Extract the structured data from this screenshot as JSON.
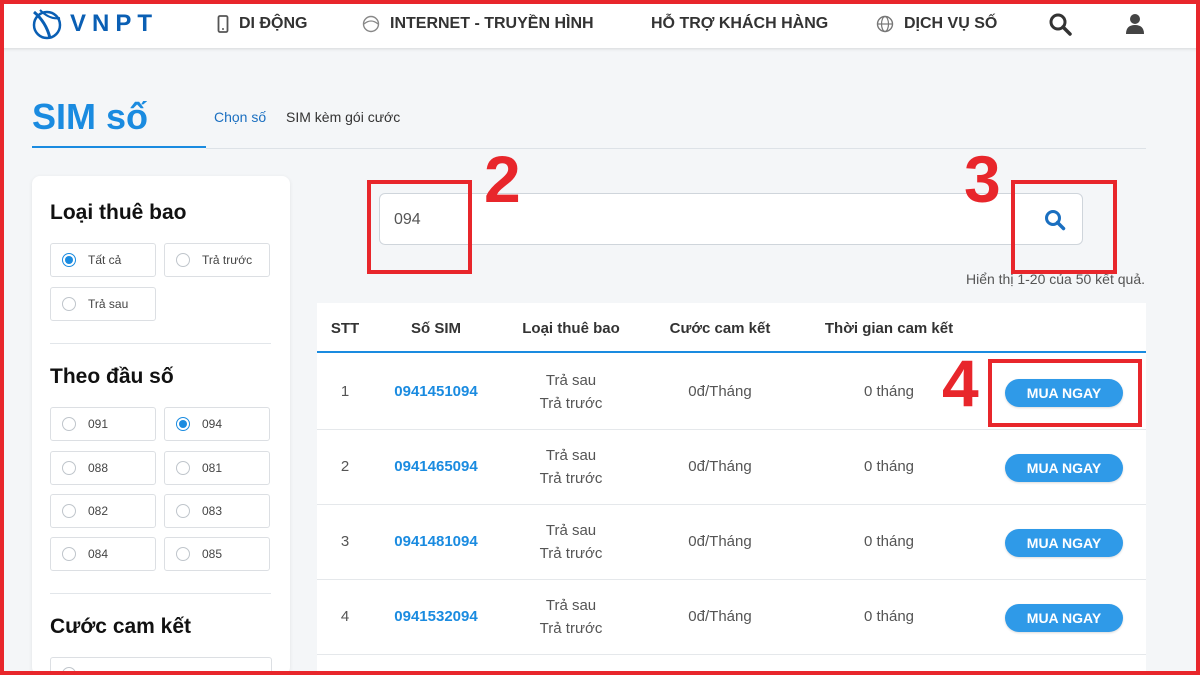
{
  "header": {
    "logo_text": "VNPT",
    "nav": [
      {
        "label": "DI ĐỘNG",
        "icon": "mobile-phone-icon"
      },
      {
        "label": "INTERNET - TRUYỀN HÌNH",
        "icon": "globe-icon"
      },
      {
        "label": "HỖ TRỢ KHÁCH HÀNG",
        "icon": ""
      },
      {
        "label": "DỊCH VỤ SỐ",
        "icon": "globe-grid-icon"
      }
    ],
    "search_icon": "search-icon",
    "user_icon": "user-icon"
  },
  "page": {
    "title": "SIM số",
    "tabs": [
      {
        "label": "Chọn số",
        "active": true
      },
      {
        "label": "SIM kèm gói cước",
        "active": false
      }
    ]
  },
  "sidebar": {
    "subscriber_type": {
      "heading": "Loại thuê bao",
      "options": [
        {
          "label": "Tất cả",
          "checked": true
        },
        {
          "label": "Trả trước",
          "checked": false
        },
        {
          "label": "Trả sau",
          "checked": false
        }
      ]
    },
    "prefix": {
      "heading": "Theo đầu số",
      "options": [
        {
          "label": "091",
          "checked": false
        },
        {
          "label": "094",
          "checked": true
        },
        {
          "label": "088",
          "checked": false
        },
        {
          "label": "081",
          "checked": false
        },
        {
          "label": "082",
          "checked": false
        },
        {
          "label": "083",
          "checked": false
        },
        {
          "label": "084",
          "checked": false
        },
        {
          "label": "085",
          "checked": false
        }
      ]
    },
    "commitment": {
      "heading": "Cước cam kết"
    }
  },
  "search": {
    "value": "094"
  },
  "results": {
    "info": "Hiển thị 1-20 của 50 kết quả."
  },
  "table": {
    "headers": [
      "STT",
      "Số SIM",
      "Loại thuê bao",
      "Cước cam kết",
      "Thời gian cam kết"
    ],
    "rows": [
      {
        "stt": "1",
        "sim": "0941451094",
        "type1": "Trả sau",
        "type2": "Trả trước",
        "fee": "0đ/Tháng",
        "duration": "0 tháng",
        "action": "MUA NGAY"
      },
      {
        "stt": "2",
        "sim": "0941465094",
        "type1": "Trả sau",
        "type2": "Trả trước",
        "fee": "0đ/Tháng",
        "duration": "0 tháng",
        "action": "MUA NGAY"
      },
      {
        "stt": "3",
        "sim": "0941481094",
        "type1": "Trả sau",
        "type2": "Trả trước",
        "fee": "0đ/Tháng",
        "duration": "0 tháng",
        "action": "MUA NGAY"
      },
      {
        "stt": "4",
        "sim": "0941532094",
        "type1": "Trả sau",
        "type2": "Trả trước",
        "fee": "0đ/Tháng",
        "duration": "0 tháng",
        "action": "MUA NGAY"
      }
    ]
  },
  "annotations": [
    "2",
    "3",
    "4"
  ],
  "colors": {
    "brand": "#0a5fb4",
    "accent": "#1a8be0",
    "button": "#2f9ae8",
    "annotation": "#e8262b"
  }
}
